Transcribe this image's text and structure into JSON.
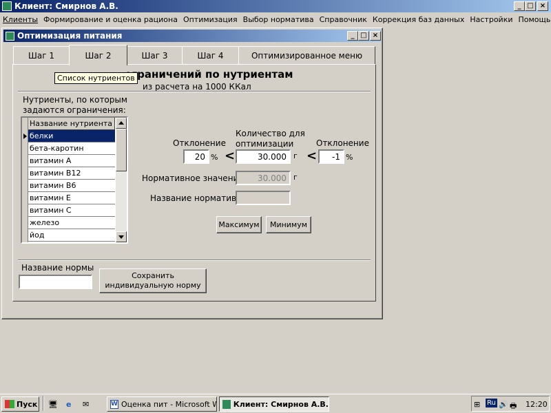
{
  "main_window": {
    "title": "Клиент: Смирнов А.В.",
    "menu": [
      "Клиенты",
      "Формирование и оценка рациона",
      "Оптимизация",
      "Выбор норматива",
      "Справочник",
      "Коррекция  баз данных",
      "Настройки",
      "Помощь"
    ]
  },
  "child_window": {
    "title": "Оптимизация питания"
  },
  "tabs": [
    "Шаг 1",
    "Шаг 2",
    "Шаг 3",
    "Шаг 4",
    "Оптимизированное меню"
  ],
  "active_tab": "Шаг 2",
  "section": {
    "heading": "ограничений по нутриентам",
    "subheading": "из расчета на 1000 ККал",
    "tooltip": "Список нутриентов"
  },
  "nutrients": {
    "caption": "Нутриенты, по которым\nзадаются ограничения:",
    "column_header": "Название нутриента",
    "items": [
      "белки",
      "бета-каротин",
      "витамин А",
      "витамин В12",
      "витамин В6",
      "витамин Е",
      "витамин С",
      "железо",
      "йод"
    ],
    "selected": "белки"
  },
  "constraints": {
    "deviation_left_label": "Отклонение",
    "deviation_left_value": "20",
    "percent": "%",
    "lt_symbol": "<",
    "quantity_label": "Количество для\nоптимизации",
    "quantity_value": "30.000",
    "unit_g": "г",
    "deviation_right_label": "Отклонение",
    "deviation_right_value": "-1",
    "normative_value_label": "Нормативное значение",
    "normative_value": "30.000",
    "normative_name_label": "Название норматива",
    "normative_name": "",
    "max_button": "Максимум",
    "min_button": "Минимум"
  },
  "norm": {
    "name_label": "Название нормы",
    "name_value": "",
    "save_button": "Сохранить\nиндивидуальную норму"
  },
  "taskbar": {
    "start": "Пуск",
    "tasks": [
      "Оценка пит - Microsoft W...",
      "Клиент: Смирнов А.В."
    ],
    "lang": "Ru",
    "clock": "12:20"
  },
  "colors": {
    "titlebar_start": "#0a246a",
    "titlebar_end": "#a6caf0",
    "face": "#d4d0c8",
    "selection": "#0a246a"
  }
}
